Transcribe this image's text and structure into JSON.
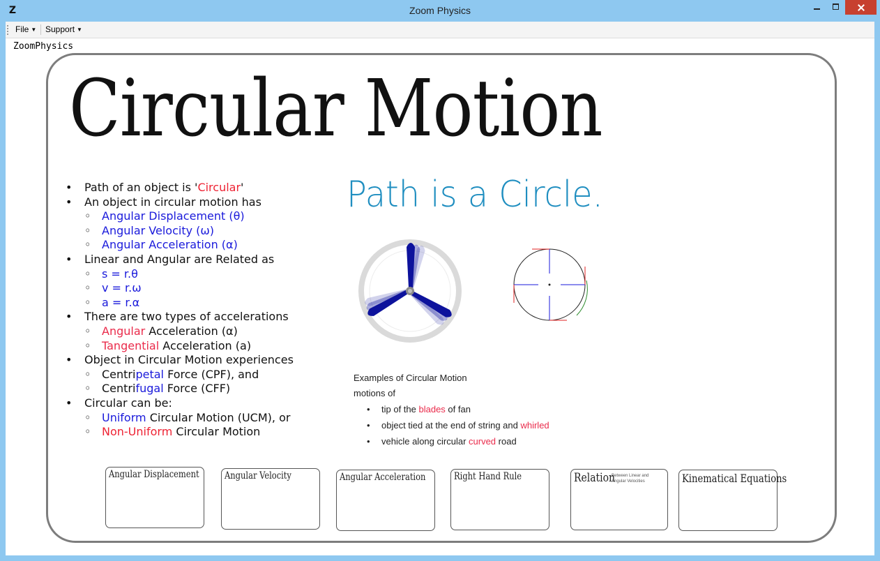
{
  "window": {
    "title": "Zoom Physics",
    "icon": "app-z-icon",
    "app_label": "ZoomPhysics"
  },
  "menu": {
    "file": "File",
    "support": "Support"
  },
  "slide": {
    "title": "Circular Motion",
    "subtitle": "Path is a Circle.",
    "bullets": {
      "path_pre": "Path of an object is '",
      "path_word": "Circular",
      "path_post": "'",
      "has": "An object in circular motion has",
      "ang_disp": "Angular Displacement (θ)",
      "ang_vel": "Angular Velocity (ω)",
      "ang_acc": "Angular Acceleration (α)",
      "related": "Linear and Angular are Related as",
      "eq1": "s = r.θ",
      "eq2": "v = r.ω",
      "eq3": "a = r.α",
      "two_types": "There are two types of accelerations",
      "angular_word": "Angular",
      "angular_rest": " Acceleration (α)",
      "tangential_word": "Tangential",
      "tangential_rest": " Acceleration (a)",
      "experiences": "Object in Circular Motion experiences",
      "centri1": "Centri",
      "petal": "petal",
      "cpf_rest": " Force (CPF), and",
      "centri2": "Centri",
      "fugal": "fugal",
      "cff_rest": " Force (CFF)",
      "can_be": "Circular can be:",
      "uniform_word": "Uniform",
      "uniform_rest": " Circular Motion (UCM), or",
      "nonuniform_word": "Non-Uniform",
      "nonuniform_rest": " Circular Motion"
    },
    "examples": {
      "heading": "Examples of Circular Motion",
      "motions": "motions of",
      "ex1_pre": "tip of the ",
      "ex1_word": "blades",
      "ex1_post": " of fan",
      "ex2_pre": "object tied at the end of string and ",
      "ex2_word": "whirled",
      "ex3_pre": "vehicle along circular ",
      "ex3_word": "curved",
      "ex3_post": " road"
    },
    "cards": [
      {
        "title": "Angular Displacement"
      },
      {
        "title": "Angular Velocity"
      },
      {
        "title": "Angular Acceleration"
      },
      {
        "title": "Right Hand Rule"
      },
      {
        "title": "Relation",
        "note": "Between Linear and Angular Velocities"
      },
      {
        "title": "Kinematical Equations"
      }
    ]
  },
  "colors": {
    "title_bar": "#8ec8f0",
    "close_button": "#c7402f",
    "subtitle": "#1f8ec0",
    "angular_blue": "#1a1adb",
    "highlight_red": "#ee2233",
    "fan_blade": "#0d129c"
  }
}
